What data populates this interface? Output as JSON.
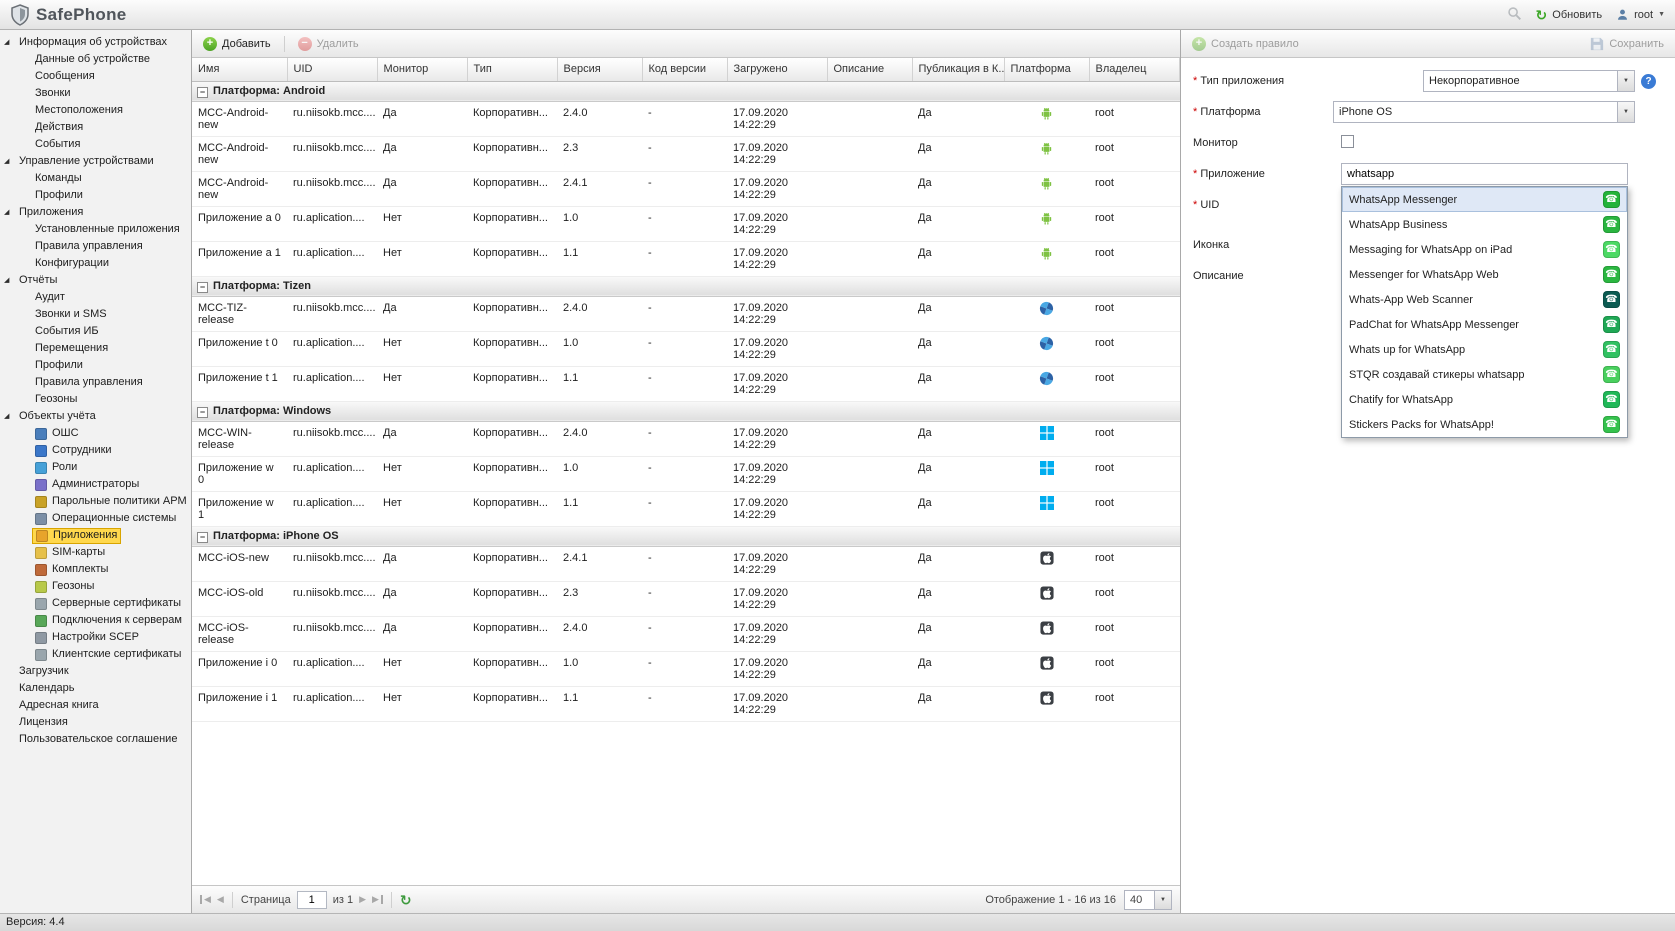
{
  "app": {
    "name": "SafePhone",
    "version": "Версия: 4.4"
  },
  "topbar": {
    "refresh": "Обновить",
    "user": "root"
  },
  "sidebar": {
    "items": [
      {
        "label": "Информация об устройствах",
        "level": 0,
        "group": true
      },
      {
        "label": "Данные об устройстве",
        "level": 1
      },
      {
        "label": "Сообщения",
        "level": 1
      },
      {
        "label": "Звонки",
        "level": 1
      },
      {
        "label": "Местоположения",
        "level": 1
      },
      {
        "label": "Действия",
        "level": 1
      },
      {
        "label": "События",
        "level": 1
      },
      {
        "label": "Управление устройствами",
        "level": 0,
        "group": true
      },
      {
        "label": "Команды",
        "level": 1
      },
      {
        "label": "Профили",
        "level": 1
      },
      {
        "label": "Приложения",
        "level": 0,
        "group": true
      },
      {
        "label": "Установленные приложения",
        "level": 1
      },
      {
        "label": "Правила управления",
        "level": 1
      },
      {
        "label": "Конфигурации",
        "level": 1
      },
      {
        "label": "Отчёты",
        "level": 0,
        "group": true
      },
      {
        "label": "Аудит",
        "level": 1
      },
      {
        "label": "Звонки и SMS",
        "level": 1
      },
      {
        "label": "События ИБ",
        "level": 1
      },
      {
        "label": "Перемещения",
        "level": 1
      },
      {
        "label": "Профили",
        "level": 1
      },
      {
        "label": "Правила управления",
        "level": 1
      },
      {
        "label": "Геозоны",
        "level": 1
      },
      {
        "label": "Объекты учёта",
        "level": 0,
        "group": true
      },
      {
        "label": "ОШС",
        "level": 1,
        "icon": "#4a7ebb",
        "icon_name": "org-structure"
      },
      {
        "label": "Сотрудники",
        "level": 1,
        "icon": "#3b77c9",
        "icon_name": "employees"
      },
      {
        "label": "Роли",
        "level": 1,
        "icon": "#46a1d8",
        "icon_name": "roles"
      },
      {
        "label": "Администраторы",
        "level": 1,
        "icon": "#7a70c9",
        "icon_name": "administrators"
      },
      {
        "label": "Парольные политики АРМ",
        "level": 1,
        "icon": "#c9a227",
        "icon_name": "password-policies"
      },
      {
        "label": "Операционные системы",
        "level": 1,
        "icon": "#7c8fa6",
        "icon_name": "operating-systems"
      },
      {
        "label": "Приложения",
        "level": 1,
        "icon": "#e8a42b",
        "icon_name": "applications",
        "selected": true
      },
      {
        "label": "SIM-карты",
        "level": 1,
        "icon": "#e6c04a",
        "icon_name": "sim-cards"
      },
      {
        "label": "Комплекты",
        "level": 1,
        "icon": "#bf6a3a",
        "icon_name": "kits"
      },
      {
        "label": "Геозоны",
        "level": 1,
        "icon": "#b8c94a",
        "icon_name": "geozones"
      },
      {
        "label": "Серверные сертификаты",
        "level": 1,
        "icon": "#9aa6ad",
        "icon_name": "server-certificates"
      },
      {
        "label": "Подключения к серверам",
        "level": 1,
        "icon": "#58a758",
        "icon_name": "server-connections"
      },
      {
        "label": "Настройки SCEP",
        "level": 1,
        "icon": "#8f99a3",
        "icon_name": "scep-settings"
      },
      {
        "label": "Клиентские сертификаты",
        "level": 1,
        "icon": "#9aa6ad",
        "icon_name": "client-certificates"
      },
      {
        "label": "Загрузчик",
        "level": 0
      },
      {
        "label": "Календарь",
        "level": 0
      },
      {
        "label": "Адресная книга",
        "level": 0
      },
      {
        "label": "Лицензия",
        "level": 0
      },
      {
        "label": "Пользовательское соглашение",
        "level": 0
      }
    ]
  },
  "main": {
    "toolbar": {
      "add": "Добавить",
      "delete": "Удалить"
    },
    "table": {
      "columns": [
        "Имя",
        "UID",
        "Монитор",
        "Тип",
        "Версия",
        "Код версии",
        "Загружено",
        "Описание",
        "Публикация в К...",
        "Платформа",
        "Владелец"
      ],
      "groups": [
        {
          "label": "Платформа: Android",
          "rows": [
            {
              "name": "MCC-Android-new",
              "uid": "ru.niisokb.mcc....",
              "monitor": "Да",
              "type": "Корпоративн...",
              "version": "2.4.0",
              "version_code": "-",
              "date": "17.09.2020",
              "time": "14:22:29",
              "description": "",
              "publication": "Да",
              "platform": "android",
              "owner": "root"
            },
            {
              "name": "MCC-Android-new",
              "uid": "ru.niisokb.mcc....",
              "monitor": "Да",
              "type": "Корпоративн...",
              "version": "2.3",
              "version_code": "-",
              "date": "17.09.2020",
              "time": "14:22:29",
              "description": "",
              "publication": "Да",
              "platform": "android",
              "owner": "root"
            },
            {
              "name": "MCC-Android-new",
              "uid": "ru.niisokb.mcc....",
              "monitor": "Да",
              "type": "Корпоративн...",
              "version": "2.4.1",
              "version_code": "-",
              "date": "17.09.2020",
              "time": "14:22:29",
              "description": "",
              "publication": "Да",
              "platform": "android",
              "owner": "root"
            },
            {
              "name": "Приложение a 0",
              "uid": "ru.aplication....",
              "monitor": "Нет",
              "type": "Корпоративн...",
              "version": "1.0",
              "version_code": "-",
              "date": "17.09.2020",
              "time": "14:22:29",
              "description": "",
              "publication": "Да",
              "platform": "android",
              "owner": "root"
            },
            {
              "name": "Приложение a 1",
              "uid": "ru.aplication....",
              "monitor": "Нет",
              "type": "Корпоративн...",
              "version": "1.1",
              "version_code": "-",
              "date": "17.09.2020",
              "time": "14:22:29",
              "description": "",
              "publication": "Да",
              "platform": "android",
              "owner": "root"
            }
          ]
        },
        {
          "label": "Платформа: Tizen",
          "rows": [
            {
              "name": "MCC-TIZ-release",
              "uid": "ru.niisokb.mcc....",
              "monitor": "Да",
              "type": "Корпоративн...",
              "version": "2.4.0",
              "version_code": "-",
              "date": "17.09.2020",
              "time": "14:22:29",
              "description": "",
              "publication": "Да",
              "platform": "tizen",
              "owner": "root"
            },
            {
              "name": "Приложение t 0",
              "uid": "ru.aplication....",
              "monitor": "Нет",
              "type": "Корпоративн...",
              "version": "1.0",
              "version_code": "-",
              "date": "17.09.2020",
              "time": "14:22:29",
              "description": "",
              "publication": "Да",
              "platform": "tizen",
              "owner": "root"
            },
            {
              "name": "Приложение t 1",
              "uid": "ru.aplication....",
              "monitor": "Нет",
              "type": "Корпоративн...",
              "version": "1.1",
              "version_code": "-",
              "date": "17.09.2020",
              "time": "14:22:29",
              "description": "",
              "publication": "Да",
              "platform": "tizen",
              "owner": "root"
            }
          ]
        },
        {
          "label": "Платформа: Windows",
          "rows": [
            {
              "name": "MCC-WIN-release",
              "uid": "ru.niisokb.mcc....",
              "monitor": "Да",
              "type": "Корпоративн...",
              "version": "2.4.0",
              "version_code": "-",
              "date": "17.09.2020",
              "time": "14:22:29",
              "description": "",
              "publication": "Да",
              "platform": "windows",
              "owner": "root"
            },
            {
              "name": "Приложение w 0",
              "uid": "ru.aplication....",
              "monitor": "Нет",
              "type": "Корпоративн...",
              "version": "1.0",
              "version_code": "-",
              "date": "17.09.2020",
              "time": "14:22:29",
              "description": "",
              "publication": "Да",
              "platform": "windows",
              "owner": "root"
            },
            {
              "name": "Приложение w 1",
              "uid": "ru.aplication....",
              "monitor": "Нет",
              "type": "Корпоративн...",
              "version": "1.1",
              "version_code": "-",
              "date": "17.09.2020",
              "time": "14:22:29",
              "description": "",
              "publication": "Да",
              "platform": "windows",
              "owner": "root"
            }
          ]
        },
        {
          "label": "Платформа: iPhone OS",
          "rows": [
            {
              "name": "MCC-iOS-new",
              "uid": "ru.niisokb.mcc....",
              "monitor": "Да",
              "type": "Корпоративн...",
              "version": "2.4.1",
              "version_code": "-",
              "date": "17.09.2020",
              "time": "14:22:29",
              "description": "",
              "publication": "Да",
              "platform": "apple",
              "owner": "root"
            },
            {
              "name": "MCC-iOS-old",
              "uid": "ru.niisokb.mcc....",
              "monitor": "Да",
              "type": "Корпоративн...",
              "version": "2.3",
              "version_code": "-",
              "date": "17.09.2020",
              "time": "14:22:29",
              "description": "",
              "publication": "Да",
              "platform": "apple",
              "owner": "root"
            },
            {
              "name": "MCC-iOS-release",
              "uid": "ru.niisokb.mcc....",
              "monitor": "Да",
              "type": "Корпоративн...",
              "version": "2.4.0",
              "version_code": "-",
              "date": "17.09.2020",
              "time": "14:22:29",
              "description": "",
              "publication": "Да",
              "platform": "apple",
              "owner": "root"
            },
            {
              "name": "Приложение i 0",
              "uid": "ru.aplication....",
              "monitor": "Нет",
              "type": "Корпоративн...",
              "version": "1.0",
              "version_code": "-",
              "date": "17.09.2020",
              "time": "14:22:29",
              "description": "",
              "publication": "Да",
              "platform": "apple",
              "owner": "root"
            },
            {
              "name": "Приложение i 1",
              "uid": "ru.aplication....",
              "monitor": "Нет",
              "type": "Корпоративн...",
              "version": "1.1",
              "version_code": "-",
              "date": "17.09.2020",
              "time": "14:22:29",
              "description": "",
              "publication": "Да",
              "platform": "apple",
              "owner": "root"
            }
          ]
        }
      ]
    },
    "pagination": {
      "page_label": "Страница",
      "page": "1",
      "of": "из 1",
      "display": "Отображение 1 - 16 из 16",
      "page_size": "40"
    }
  },
  "panel": {
    "toolbar": {
      "create_rule": "Создать правило",
      "save": "Сохранить"
    },
    "form": {
      "app_type_label": "Тип приложения",
      "app_type_value": "Некорпоративное",
      "platform_label": "Платформа",
      "platform_value": "iPhone OS",
      "monitor_label": "Монитор",
      "monitor_checked": false,
      "application_label": "Приложение",
      "application_value": "whatsapp",
      "uid_label": "UID",
      "icon_label": "Иконка",
      "description_label": "Описание"
    },
    "suggestions": [
      {
        "label": "WhatsApp Messenger",
        "selected": true,
        "color": "#23b33a"
      },
      {
        "label": "WhatsApp Business",
        "color": "#2ab540"
      },
      {
        "label": "Messaging for WhatsApp on iPad",
        "color": "#4cd964"
      },
      {
        "label": "Messenger for WhatsApp Web",
        "color": "#2bb741"
      },
      {
        "label": "Whats-App Web Scanner",
        "color": "#0c5b52"
      },
      {
        "label": "PadChat for WhatsApp Messenger",
        "color": "#1fa855"
      },
      {
        "label": "Whats up for WhatsApp",
        "color": "#31c162"
      },
      {
        "label": "STQR создавай стикеры whatsapp",
        "color": "#49d05e"
      },
      {
        "label": "Chatify for WhatsApp",
        "color": "#20b858"
      },
      {
        "label": "Stickers Packs for WhatsApp!",
        "color": "#35c24d"
      }
    ]
  }
}
